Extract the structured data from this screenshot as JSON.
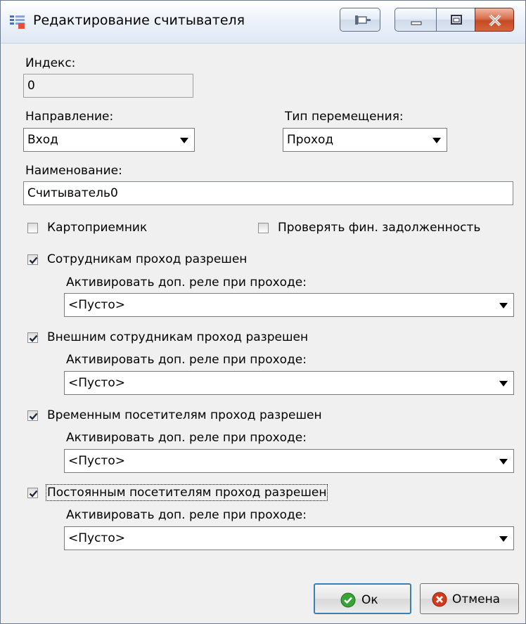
{
  "window": {
    "title": "Редактирование считывателя"
  },
  "form": {
    "index_label": "Индекс:",
    "index_value": "0",
    "direction_label": "Направление:",
    "direction_value": "Вход",
    "movement_type_label": "Тип перемещения:",
    "movement_type_value": "Проход",
    "name_label": "Наименование:",
    "name_value": "Считыватель0",
    "card_receiver_label": "Картоприемник",
    "card_receiver_checked": false,
    "check_debt_label": "Проверять фин. задолженность",
    "check_debt_checked": false
  },
  "groups": [
    {
      "label": "Сотрудникам проход разрешен",
      "checked": true,
      "relay_label": "Активировать доп. реле при проходе:",
      "relay_value": "<Пусто>"
    },
    {
      "label": "Внешним сотрудникам проход разрешен",
      "checked": true,
      "relay_label": "Активировать доп. реле при проходе:",
      "relay_value": "<Пусто>"
    },
    {
      "label": "Временным посетителям проход разрешен",
      "checked": true,
      "relay_label": "Активировать доп. реле при проходе:",
      "relay_value": "<Пусто>"
    },
    {
      "label": "Постоянным посетителям проход разрешен",
      "checked": true,
      "relay_label": "Активировать доп. реле при проходе:",
      "relay_value": "<Пусто>"
    }
  ],
  "buttons": {
    "ok_label": "Ок",
    "cancel_label": "Отмена"
  },
  "colors": {
    "ok_icon": "#3aa335",
    "cancel_icon": "#d23a1e",
    "close_button": "#c44a24"
  }
}
